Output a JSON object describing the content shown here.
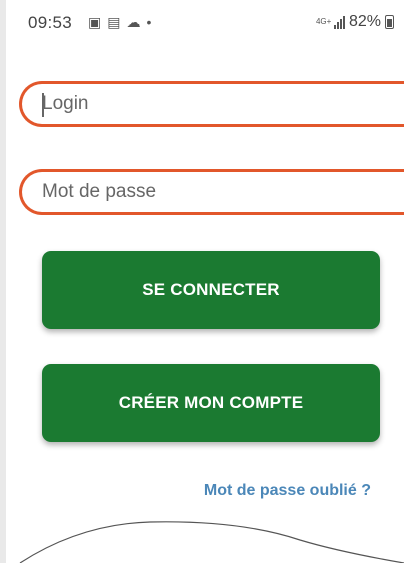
{
  "status_bar": {
    "time": "09:53",
    "notification_icons": [
      "image-icon",
      "teams-icon",
      "cloud-icon",
      "dot-icon"
    ],
    "network": "4G+",
    "battery_percent": "82%"
  },
  "login_form": {
    "login_placeholder": "Login",
    "password_placeholder": "Mot de passe",
    "login_button": "SE CONNECTER",
    "register_button": "CRÉER MON COMPTE",
    "forgot_password": "Mot de passe oublié ?"
  },
  "colors": {
    "accent_orange": "#e2572b",
    "button_green": "#1b7a31",
    "link_blue": "#4b87b8"
  }
}
